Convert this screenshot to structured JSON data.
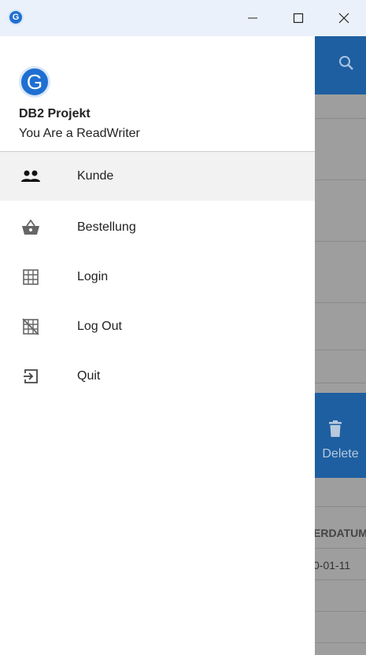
{
  "titlebar": {
    "app_icon_letter": "G",
    "minimize_glyph": "—",
    "maximize_glyph": "☐",
    "close_glyph": "✕"
  },
  "drawer": {
    "avatar_letter": "G",
    "project_title": "DB2 Projekt",
    "role_text": "You Are a ReadWriter",
    "items": [
      {
        "label": "Kunde",
        "icon": "people-icon",
        "active": true
      },
      {
        "label": "Bestellung",
        "icon": "basket-icon",
        "active": false
      },
      {
        "label": "Login",
        "icon": "grid-icon",
        "active": false
      },
      {
        "label": "Log Out",
        "icon": "grid-off-icon",
        "active": false
      },
      {
        "label": "Quit",
        "icon": "exit-icon",
        "active": false
      }
    ]
  },
  "background": {
    "delete_label": "Delete",
    "column_header_fragment": "ERDATUM",
    "cell_fragment": "0-01-11"
  },
  "colors": {
    "accent": "#1e5fa1",
    "overlay": "#9e9e9e",
    "titlebar": "#eaf1fb"
  }
}
